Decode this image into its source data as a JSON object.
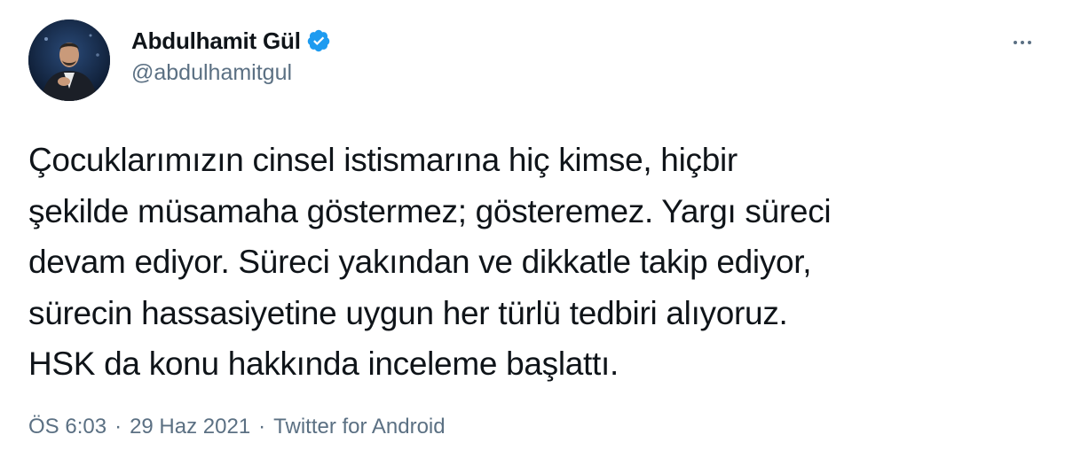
{
  "author": {
    "display_name": "Abdulhamit Gül",
    "handle": "@abdulhamitgul",
    "verified_icon": "verified-badge-icon",
    "avatar_icon": "profile-photo",
    "more_icon": "more-options-icon"
  },
  "tweet": {
    "lines": [
      "Çocuklarımızın cinsel istismarına hiç kimse, hiçbir",
      "şekilde müsamaha göstermez; gösteremez. Yargı süreci",
      "devam ediyor. Süreci yakından ve dikkatle takip ediyor,",
      "sürecin hassasiyetine uygun her türlü tedbiri alıyoruz.",
      "HSK da konu hakkında inceleme başlattı."
    ],
    "time": "ÖS 6:03",
    "separator": "·",
    "date": "29 Haz 2021",
    "source": "Twitter for Android"
  },
  "colors": {
    "text": "#0f1419",
    "secondary": "#5b7083",
    "verified": "#1d9bf0",
    "background": "#ffffff"
  }
}
